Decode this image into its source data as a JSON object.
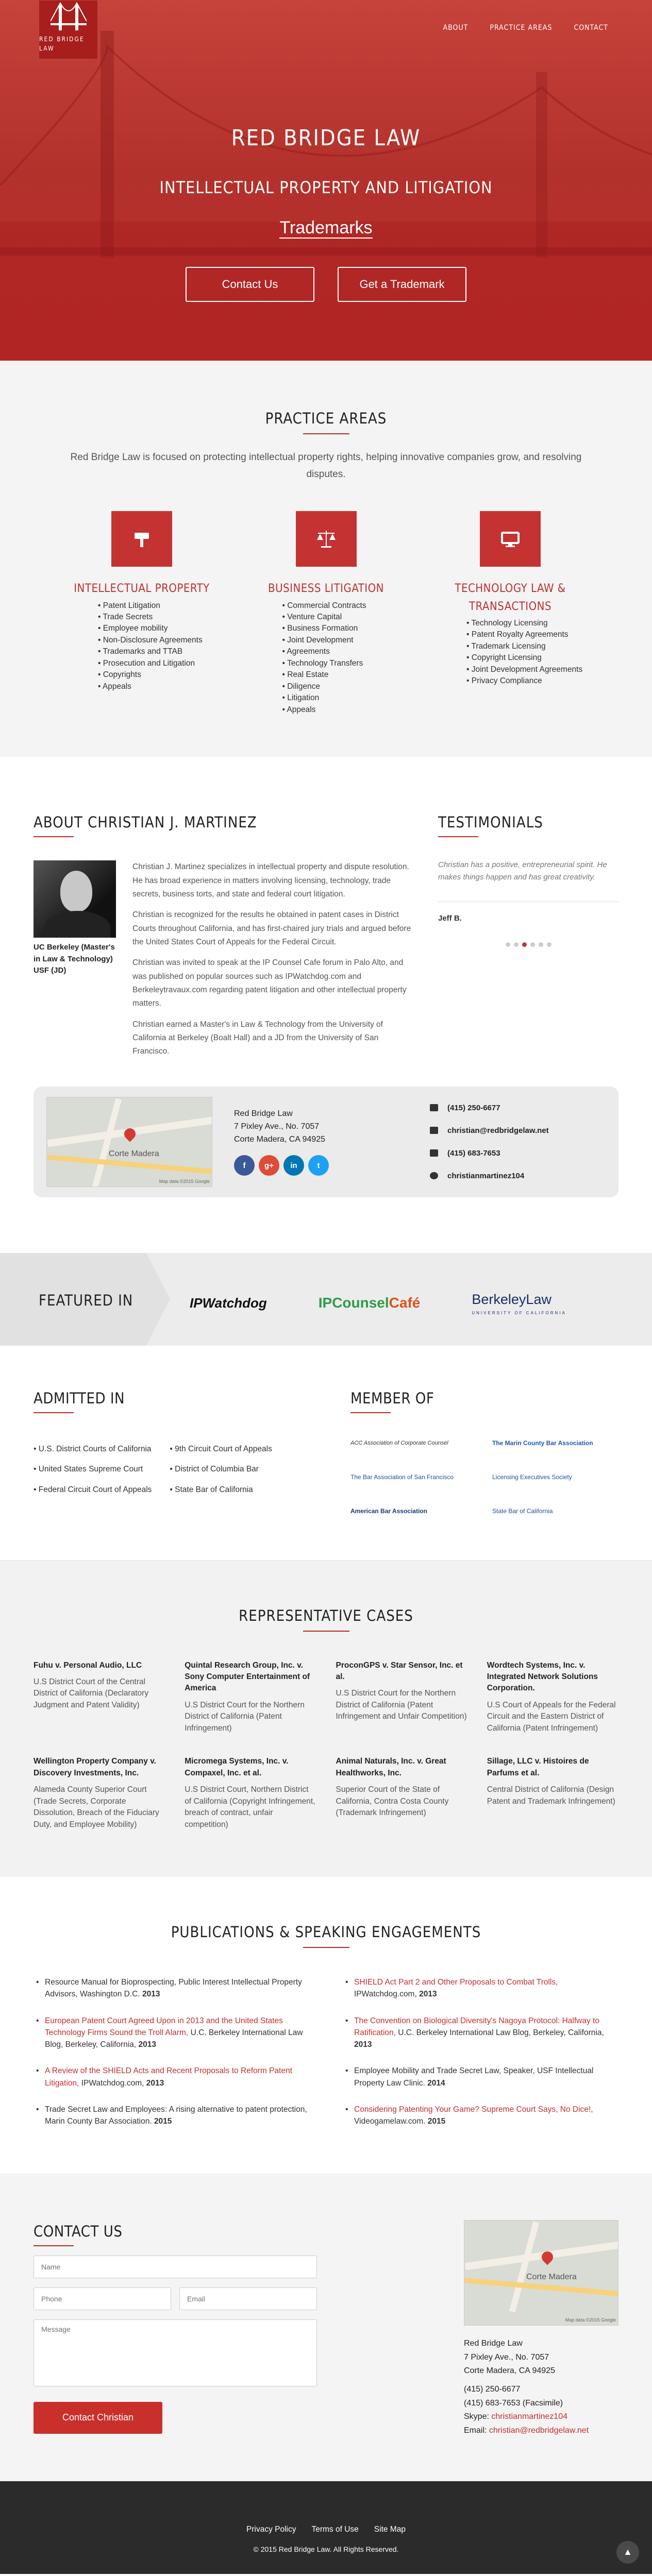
{
  "header": {
    "logo_text": "RED BRIDGE LAW",
    "nav": [
      "ABOUT",
      "PRACTICE AREAS",
      "CONTACT"
    ]
  },
  "hero": {
    "title": "RED BRIDGE LAW",
    "subtitle": "INTELLECTUAL PROPERTY AND LITIGATION",
    "tagline": "Trademarks",
    "btn_contact": "Contact Us",
    "btn_trademark": "Get a Trademark"
  },
  "practice": {
    "title": "PRACTICE AREAS",
    "intro": "Red Bridge Law is focused on protecting intellectual property rights, helping innovative companies grow, and resolving disputes.",
    "areas": [
      {
        "title": "INTELLECTUAL PROPERTY",
        "icon": "gavel-icon",
        "items": [
          "Patent Litigation",
          "Trade Secrets",
          "Employee mobility",
          "Non-Disclosure Agreements",
          "Trademarks and TTAB",
          "Prosecution and Litigation",
          "Copyrights",
          "Appeals"
        ]
      },
      {
        "title": "BUSINESS LITIGATION",
        "icon": "scales-icon",
        "items": [
          "Commercial Contracts",
          "Venture Capital",
          "Business Formation",
          "Joint Development",
          "Agreements",
          "Technology Transfers",
          "Real Estate",
          "Diligence",
          "Litigation",
          "Appeals"
        ]
      },
      {
        "title": "TECHNOLOGY LAW & TRANSACTIONS",
        "icon": "monitor-icon",
        "items": [
          "Technology Licensing",
          "Patent Royalty Agreements",
          "Trademark Licensing",
          "Copyright Licensing",
          "Joint Development Agreements",
          "Privacy Compliance"
        ]
      }
    ]
  },
  "about": {
    "title": "ABOUT CHRISTIAN J. MARTINEZ",
    "caption": "UC Berkeley (Master's in Law & Technology) USF (JD)",
    "bio": [
      "Christian J. Martinez specializes in intellectual property and dispute resolution. He has broad experience in matters involving licensing, technology, trade secrets, business torts, and state and federal court litigation.",
      "Christian is recognized for the results he obtained in patent cases in District Courts throughout California, and has first-chaired jury trials and argued before the United States Court of Appeals for the Federal Circuit.",
      "Christian was invited to speak at the IP Counsel Cafe forum in Palo Alto, and was published on popular sources such as IPWatchdog.com and Berkeleytravaux.com regarding patent litigation and other intellectual property matters.",
      "Christian earned a Master's in Law & Technology from the University of California at Berkeley (Boalt Hall) and a JD from the University of San Francisco."
    ]
  },
  "testimonials": {
    "title": "TESTIMONIALS",
    "quote": "Christian has a positive, entrepreneurial spirit. He makes things happen and has great creativity.",
    "author": "Jeff B.",
    "active_dot": 2
  },
  "card": {
    "map_label": "Corte Madera",
    "map_footer": "Map data ©2015 Google",
    "name": "Red Bridge Law",
    "street": "7 Pixley Ave., No. 7057",
    "city": "Corte Madera, CA 94925",
    "phone": "(415) 250-6677",
    "email": "christian@redbridgelaw.net",
    "fax": "(415) 683-7653",
    "skype": "christianmartinez104",
    "social": [
      "f",
      "g+",
      "in",
      "t"
    ],
    "colors": {
      "facebook": "#3b5998",
      "google": "#dd4b39",
      "linkedin": "#0077b5",
      "twitter": "#1da1f2"
    }
  },
  "featured": {
    "label": "FEATURED IN",
    "logos": {
      "ipw": "IPWatchdog",
      "cc_a": "IPCounsel",
      "cc_b": "Café",
      "bl": "BerkeleyLaw",
      "bl_sub": "UNIVERSITY OF CALIFORNIA"
    }
  },
  "admitted": {
    "title": "ADMITTED IN",
    "col1": [
      "U.S. District Courts of California",
      "United States Supreme Court",
      "Federal Circuit Court of Appeals"
    ],
    "col2": [
      "9th Circuit Court of Appeals",
      "District of Columbia Bar",
      "State Bar of California"
    ]
  },
  "member": {
    "title": "MEMBER OF",
    "items": [
      "ACC Association of Corporate Counsel",
      "The Marin County Bar Association",
      "The Bar Association of San Francisco",
      "Licensing Executives Society",
      "American Bar Association",
      "State Bar of California",
      "",
      ""
    ]
  },
  "cases": {
    "title": "REPRESENTATIVE CASES",
    "items": [
      {
        "name": "Fuhu v. Personal Audio, LLC",
        "desc": "U.S District Court of the Central District of California (Declaratory Judgment and Patent Validity)"
      },
      {
        "name": "Quintal Research Group, Inc. v. Sony Computer Entertainment of America",
        "desc": "U.S District Court for the Northern District of California (Patent Infringement)"
      },
      {
        "name": "ProconGPS v. Star Sensor, Inc. et al.",
        "desc": "U.S District Court for the Northern District of California (Patent Infringement and Unfair Competition)"
      },
      {
        "name": "Wordtech Systems, Inc. v. Integrated Network Solutions Corporation.",
        "desc": "U.S Court of Appeals for the Federal Circuit and the Eastern District of California (Patent Infringement)"
      },
      {
        "name": "Wellington Property Company v. Discovery Investments, Inc.",
        "desc": "Alameda County Superior Court (Trade Secrets, Corporate Dissolution, Breach of the Fiduciary Duty, and Employee Mobility)"
      },
      {
        "name": "Micromega Systems, Inc. v. Compaxel, Inc. et al.",
        "desc": "U.S District Court, Northern District of California (Copyright Infringement, breach of contract, unfair competition)"
      },
      {
        "name": "Animal Naturals, Inc. v. Great Healthworks, Inc.",
        "desc": "Superior Court of the State of California, Contra Costa County (Trademark Infringement)"
      },
      {
        "name": "Sillage, LLC v. Histoires de Parfums et al.",
        "desc": "Central District of California (Design Patent and Trademark Infringement)"
      }
    ]
  },
  "pubs": {
    "title": "PUBLICATIONS & SPEAKING ENGAGEMENTS",
    "items": [
      {
        "link": "",
        "text": "Resource Manual for Bioprospecting, Public Interest Intellectual Property Advisors, Washington D.C.",
        "year": "2013"
      },
      {
        "link": "SHIELD Act Part 2 and Other Proposals to Combat Trolls,",
        "text": "IPWatchdog.com,",
        "year": "2013"
      },
      {
        "link": "European Patent Court Agreed Upon in 2013 and the United States Technology Firms Sound the Troll Alarm,",
        "text": "U.C. Berkeley International Law Blog, Berkeley, California,",
        "year": "2013"
      },
      {
        "link": "The Convention on Biological Diversity's Nagoya Protocol: Halfway to Ratification,",
        "text": "U.C. Berkeley International Law Blog, Berkeley, California,",
        "year": "2013"
      },
      {
        "link": "A Review of the SHIELD Acts and Recent Proposals to Reform Patent Litigation,",
        "text": "IPWatchdog.com,",
        "year": "2013"
      },
      {
        "link": "",
        "text": "Employee Mobility and Trade Secret Law, Speaker, USF Intellectual Property Law Clinic.",
        "year": "2014"
      },
      {
        "link": "",
        "text": "Trade Secret Law and Employees: A rising alternative to patent protection, Marin County Bar Association.",
        "year": "2015"
      },
      {
        "link": "Considering Patenting Your Game? Supreme Court Says, No Dice!,",
        "text": "Videogamelaw.com.",
        "year": "2015"
      }
    ]
  },
  "contact": {
    "title": "CONTACT US",
    "ph_name": "Name",
    "ph_phone": "Phone",
    "ph_email": "Email",
    "ph_message": "Message",
    "submit": "Contact Christian",
    "name": "Red Bridge Law",
    "street": "7 Pixley Ave., No. 7057",
    "city": "Corte Madera, CA 94925",
    "phone": "(415) 250-6677",
    "fax": "(415) 683-7653 (Facsimile)",
    "skype_label": "Skype:",
    "skype": "christianmartinez104",
    "email_label": "Email:",
    "email": "christian@redbridgelaw.net"
  },
  "footer": {
    "links": [
      "Privacy Policy",
      "Terms of Use",
      "Site Map"
    ],
    "copy": "© 2015 Red Bridge Law. All Rights Reserved."
  }
}
